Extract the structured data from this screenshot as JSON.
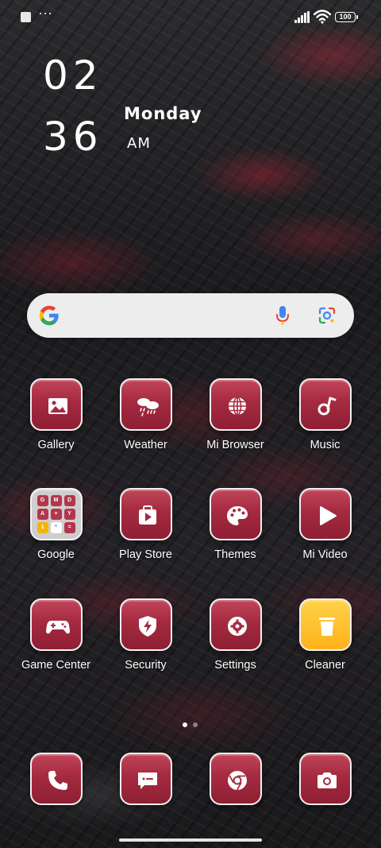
{
  "status_bar": {
    "notification_icons": [
      "square-icon",
      "more-dots-icon"
    ],
    "dots": "···",
    "signal_icon": "cellular-signal-icon",
    "wifi_icon": "wifi-icon",
    "battery": "100"
  },
  "clock": {
    "hour": "02",
    "minute": "36",
    "day": "Monday",
    "ampm": "AM"
  },
  "search": {
    "logo": "google-g-logo",
    "mic_icon": "microphone-icon",
    "lens_icon": "google-lens-icon"
  },
  "apps": [
    {
      "label": "Gallery",
      "icon": "gallery-icon"
    },
    {
      "label": "Weather",
      "icon": "weather-icon"
    },
    {
      "label": "Mi Browser",
      "icon": "globe-icon"
    },
    {
      "label": "Music",
      "icon": "music-note-icon"
    },
    {
      "label": "Google",
      "icon": "folder-icon"
    },
    {
      "label": "Play Store",
      "icon": "play-store-icon"
    },
    {
      "label": "Themes",
      "icon": "palette-icon"
    },
    {
      "label": "Mi Video",
      "icon": "play-icon"
    },
    {
      "label": "Game Center",
      "icon": "gamepad-icon"
    },
    {
      "label": "Security",
      "icon": "shield-icon"
    },
    {
      "label": "Settings",
      "icon": "gear-icon"
    },
    {
      "label": "Cleaner",
      "icon": "trash-icon"
    }
  ],
  "folder_minis": [
    "G",
    "M",
    "D",
    "A",
    "+",
    "Y",
    "1",
    "*",
    "="
  ],
  "dock": [
    {
      "icon": "phone-icon"
    },
    {
      "icon": "messages-icon"
    },
    {
      "icon": "chrome-icon"
    },
    {
      "icon": "camera-icon"
    }
  ],
  "page_indicator": {
    "pages": 2,
    "active": 0
  },
  "colors": {
    "icon_red": "#a52a40",
    "icon_border": "#f1f1f1",
    "cleaner_yellow": "#ffc233",
    "search_bg": "#ededee"
  }
}
